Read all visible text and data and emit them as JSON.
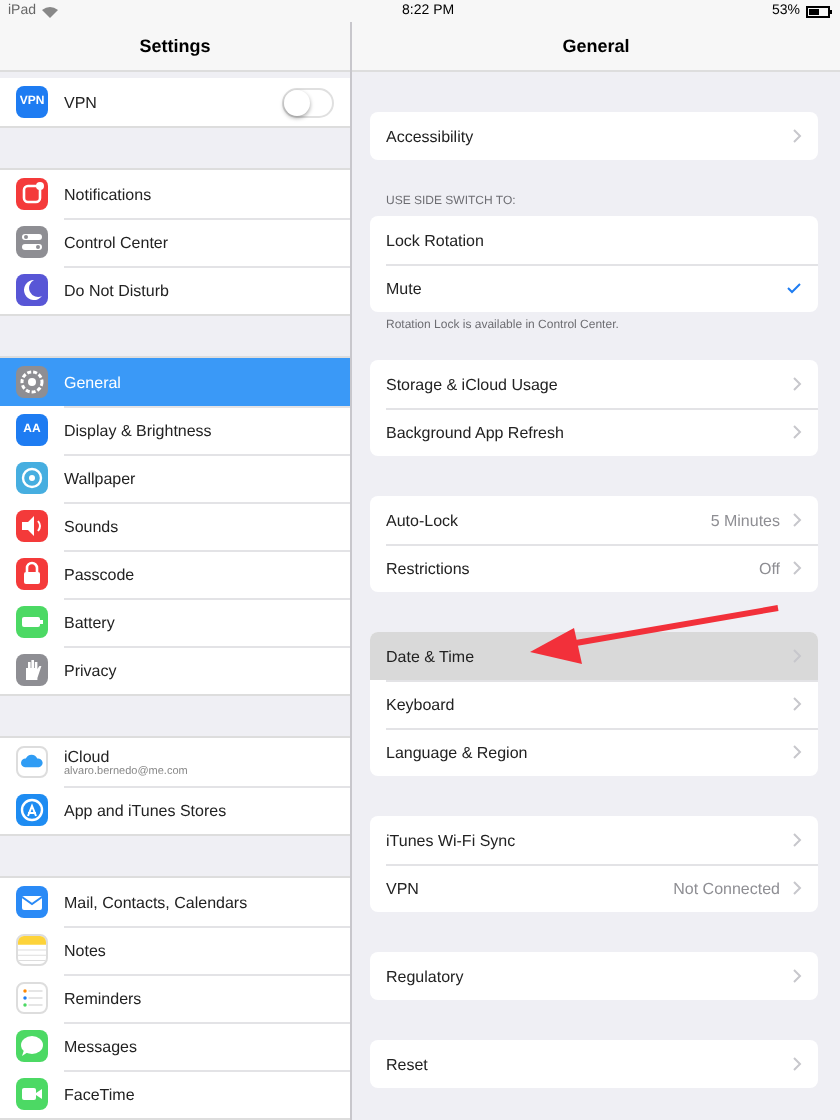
{
  "status_bar": {
    "device": "iPad",
    "time": "8:22 PM",
    "battery": "53%"
  },
  "sidebar": {
    "title": "Settings",
    "groups": [
      {
        "items": [
          {
            "label": "VPN",
            "kind": "vpn",
            "icon_text": "VPN",
            "on": false,
            "selected": false
          }
        ]
      },
      {
        "items": [
          {
            "label": "Notifications",
            "kind": "notifications",
            "selected": false
          },
          {
            "label": "Control Center",
            "kind": "control",
            "selected": false
          },
          {
            "label": "Do Not Disturb",
            "kind": "moon",
            "selected": false
          }
        ]
      },
      {
        "items": [
          {
            "label": "General",
            "kind": "gear",
            "selected": true
          },
          {
            "label": "Display & Brightness",
            "kind": "display",
            "icon_text": "AA",
            "selected": false
          },
          {
            "label": "Wallpaper",
            "kind": "flower",
            "selected": false
          },
          {
            "label": "Sounds",
            "kind": "speaker",
            "selected": false
          },
          {
            "label": "Passcode",
            "kind": "lock",
            "selected": false
          },
          {
            "label": "Battery",
            "kind": "battery",
            "selected": false
          },
          {
            "label": "Privacy",
            "kind": "hand",
            "selected": false
          }
        ]
      },
      {
        "items": [
          {
            "label": "iCloud",
            "sublabel": "alvaro.bernedo@me.com",
            "kind": "cloud",
            "selected": false
          },
          {
            "label": "App and iTunes Stores",
            "kind": "store",
            "selected": false
          }
        ]
      },
      {
        "items": [
          {
            "label": "Mail, Contacts, Calendars",
            "kind": "mail",
            "selected": false
          },
          {
            "label": "Notes",
            "kind": "notes",
            "selected": false
          },
          {
            "label": "Reminders",
            "kind": "reminders",
            "selected": false
          },
          {
            "label": "Messages",
            "kind": "bubble",
            "selected": false
          },
          {
            "label": "FaceTime",
            "kind": "camera",
            "selected": false
          }
        ]
      }
    ]
  },
  "detail": {
    "title": "General",
    "groups": [
      {
        "rows": [
          {
            "label": "Accessibility",
            "kind": "nav",
            "highlighted": false
          }
        ]
      },
      {
        "header": "USE SIDE SWITCH TO:",
        "footer": "Rotation Lock is available in Control Center.",
        "rows": [
          {
            "label": "Lock Rotation",
            "kind": "option",
            "checked": false
          },
          {
            "label": "Mute",
            "kind": "option",
            "checked": true
          }
        ]
      },
      {
        "rows": [
          {
            "label": "Storage & iCloud Usage",
            "kind": "nav",
            "highlighted": false
          },
          {
            "label": "Background App Refresh",
            "kind": "nav",
            "highlighted": false
          }
        ]
      },
      {
        "rows": [
          {
            "label": "Auto-Lock",
            "value": "5 Minutes",
            "kind": "nav",
            "highlighted": false
          },
          {
            "label": "Restrictions",
            "value": "Off",
            "kind": "nav",
            "highlighted": false
          }
        ]
      },
      {
        "rows": [
          {
            "label": "Date & Time",
            "kind": "nav",
            "highlighted": true
          },
          {
            "label": "Keyboard",
            "kind": "nav",
            "highlighted": false
          },
          {
            "label": "Language & Region",
            "kind": "nav",
            "highlighted": false
          }
        ]
      },
      {
        "rows": [
          {
            "label": "iTunes Wi-Fi Sync",
            "kind": "nav",
            "highlighted": false
          },
          {
            "label": "VPN",
            "value": "Not Connected",
            "kind": "nav",
            "highlighted": false
          }
        ]
      },
      {
        "rows": [
          {
            "label": "Regulatory",
            "kind": "nav",
            "highlighted": false
          }
        ]
      },
      {
        "rows": [
          {
            "label": "Reset",
            "kind": "nav",
            "highlighted": false
          }
        ]
      }
    ]
  }
}
